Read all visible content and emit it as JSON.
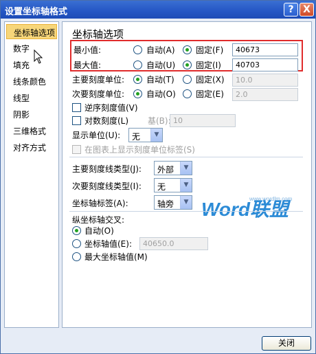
{
  "title": "设置坐标轴格式",
  "titlebar": {
    "help": "?",
    "close": "X"
  },
  "sidebar": {
    "items": [
      {
        "label": "坐标轴选项",
        "selected": true
      },
      {
        "label": "数字"
      },
      {
        "label": "填充"
      },
      {
        "label": "线条颜色"
      },
      {
        "label": "线型"
      },
      {
        "label": "阴影"
      },
      {
        "label": "三维格式"
      },
      {
        "label": "对齐方式"
      }
    ]
  },
  "panel": {
    "heading": "坐标轴选项",
    "min": {
      "label": "最小值:",
      "auto": "自动(A)",
      "fixed": "固定(F)",
      "value": "40673"
    },
    "max": {
      "label": "最大值:",
      "auto": "自动(U)",
      "fixed": "固定(I)",
      "value": "40703"
    },
    "major_unit": {
      "label": "主要刻度单位:",
      "auto": "自动(T)",
      "fixed": "固定(X)",
      "value": "10.0"
    },
    "minor_unit": {
      "label": "次要刻度单位:",
      "auto": "自动(O)",
      "fixed": "固定(E)",
      "value": "2.0"
    },
    "reverse": "逆序刻度值(V)",
    "log": {
      "label": "对数刻度(L)",
      "base_label": "基(B):",
      "base_value": "10"
    },
    "display_units": {
      "label": "显示单位(U):",
      "value": "无"
    },
    "show_units_label": "在图表上显示刻度单位标签(S)",
    "major_tick": {
      "label": "主要刻度线类型(J):",
      "value": "外部"
    },
    "minor_tick": {
      "label": "次要刻度线类型(I):",
      "value": "无"
    },
    "axis_labels": {
      "label": "坐标轴标签(A):",
      "value": "轴旁"
    },
    "cross": {
      "heading": "纵坐标轴交叉:",
      "auto": "自动(O)",
      "value_label": "坐标轴值(E):",
      "value": "40650.0",
      "max_label": "最大坐标轴值(M)"
    }
  },
  "watermark": {
    "main": "Word联盟",
    "url": "www.wordlm.com"
  },
  "close_button": "关闭"
}
